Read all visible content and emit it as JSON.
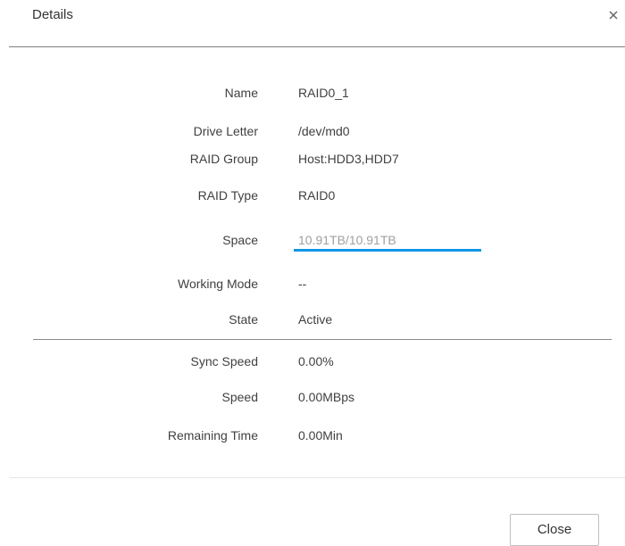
{
  "dialog": {
    "title": "Details",
    "close_button_label": "Close"
  },
  "details": [
    {
      "label": "Name",
      "value": "RAID0_1"
    },
    {
      "label": "Drive Letter",
      "value": "/dev/md0"
    },
    {
      "label": "RAID Group",
      "value": "Host:HDD3,HDD7"
    },
    {
      "label": "RAID Type",
      "value": "RAID0"
    },
    {
      "label": "Space",
      "value": "10.91TB/10.91TB"
    },
    {
      "label": "Working Mode",
      "value": "--"
    },
    {
      "label": "State",
      "value": "Active"
    }
  ],
  "sync": [
    {
      "label": "Sync Speed",
      "value": "0.00%"
    },
    {
      "label": "Speed",
      "value": "0.00MBps"
    },
    {
      "label": "Remaining Time",
      "value": "0.00Min"
    }
  ],
  "space_usage_fraction": 1.0,
  "colors": {
    "accent": "#0d97e6",
    "text": "#404040",
    "muted_value": "#a0a0a0"
  },
  "icons": {
    "close": "close-icon"
  }
}
